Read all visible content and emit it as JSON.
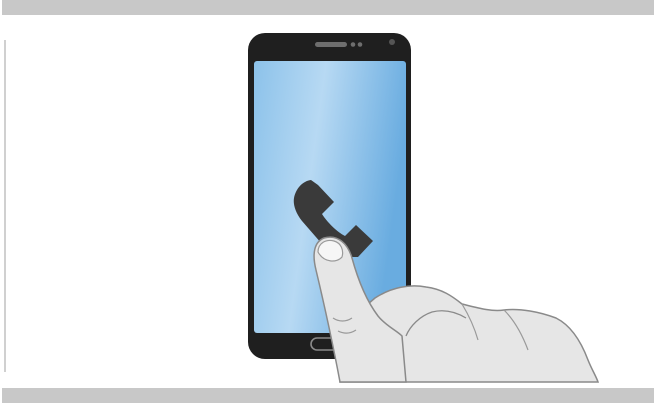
{
  "illustration": {
    "subject": "tap-call-icon",
    "icons": {
      "phone": "phone-handset-icon",
      "hand": "pointing-hand-icon"
    },
    "colors": {
      "band": "#c8c8c8",
      "phone_body": "#1f1f1f",
      "screen_light": "#b7d9f3",
      "screen_dark": "#69ace0",
      "handset": "#3a3a3a",
      "skin": "#e6e6e6",
      "skin_outline": "#8a8a8a"
    }
  }
}
